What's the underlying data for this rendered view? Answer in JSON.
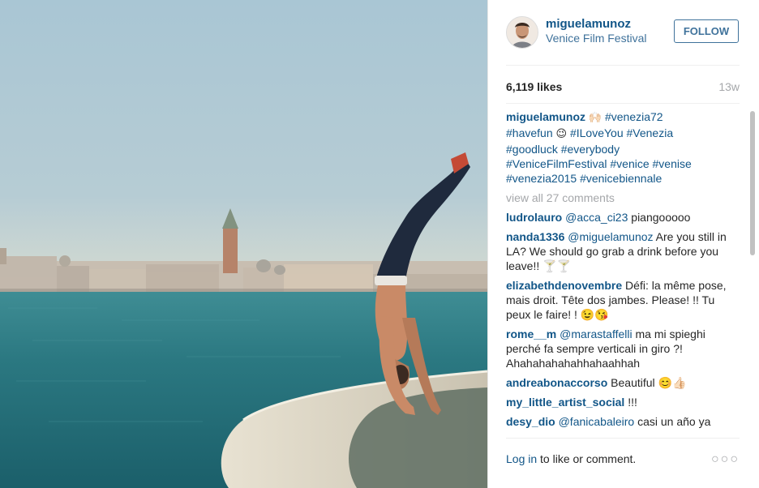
{
  "header": {
    "username": "miguelamunoz",
    "location": "Venice Film Festival",
    "follow_label": "FOLLOW"
  },
  "stats": {
    "likes": "6,119 likes",
    "time_ago": "13w"
  },
  "caption": {
    "username": "miguelamunoz",
    "emoji_1": "🙌🏻",
    "tags_line1": "#venezia72",
    "tag_havefun": "#havefun",
    "emoji_2": "😉",
    "tags_line2": "#ILoveYou #Venezia",
    "tags_line3": "#goodluck #everybody",
    "tags_line4": "#VeniceFilmFestival #venice #venise",
    "tags_line5": "#venezia2015 #venicebiennale"
  },
  "view_all": "view all 27 comments",
  "comments": [
    {
      "user": "ludrolauro",
      "mention": "@acca_ci23",
      "text": "piangooooo"
    },
    {
      "user": "nanda1336",
      "mention": "@miguelamunoz",
      "text": "Are you still in LA? We should go grab a drink before you leave!! 🍸🍸"
    },
    {
      "user": "elizabethdenovembre",
      "mention": "",
      "text": "Défi: la même pose, mais droit. Tête dos jambes. Please! !! Tu peux le faire! ! 😉😘"
    },
    {
      "user": "rome__m",
      "mention": "@marastaffelli",
      "text": "ma mi spieghi perché fa sempre verticali in giro ?! Ahahahahahahhahaahhah"
    },
    {
      "user": "andreabonaccorso",
      "mention": "",
      "text": "Beautiful 😊👍🏻"
    },
    {
      "user": "my_little_artist_social",
      "mention": "",
      "text": "!!!"
    },
    {
      "user": "desy_dio",
      "mention": "@fanicabaleiro",
      "text": "casi un año ya"
    }
  ],
  "footer": {
    "login_label": "Log in",
    "suffix": " to like or comment.",
    "more_label": "○○○"
  },
  "colors": {
    "username_blue": "#125688",
    "link_blue": "#3f729b",
    "muted_gray": "#a5a7aa",
    "water": "#1f6a75"
  },
  "icons": {
    "options": "more-options-icon"
  }
}
